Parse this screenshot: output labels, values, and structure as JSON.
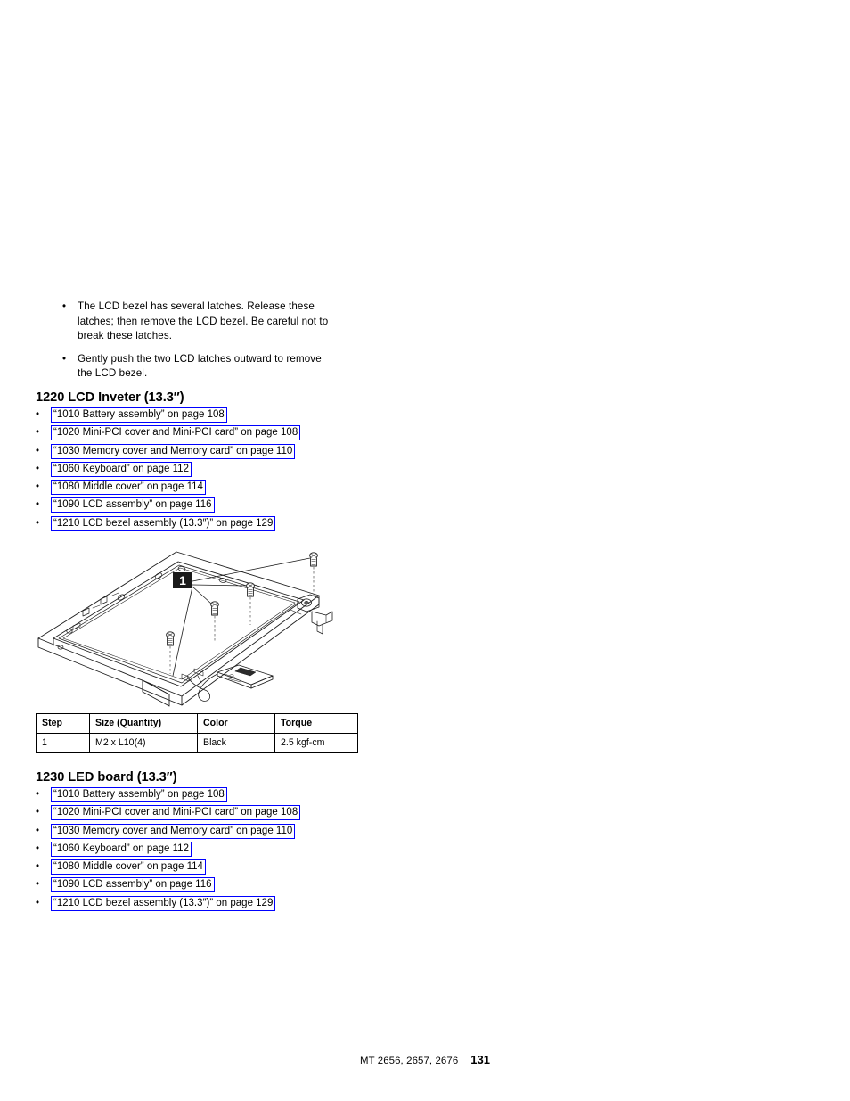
{
  "intro": {
    "bullet_glyph": "•",
    "items": [
      "The LCD bezel has several latches. Release these latches; then remove the LCD bezel. Be careful not to break these latches.",
      "Gently push the two LCD latches outward to remove the LCD bezel."
    ]
  },
  "sections": [
    {
      "heading": "1220 LCD Inveter (13.3″)",
      "links": [
        "“1010 Battery assembly” on page 108",
        "“1020 Mini-PCI cover and Mini-PCI card” on page 108",
        "“1030 Memory cover and Memory card” on page 110",
        "“1060 Keyboard” on page 112",
        "“1080 Middle cover” on page 114",
        "“1090 LCD assembly” on page 116",
        "“1210 LCD bezel assembly (13.3″)” on page 129"
      ]
    },
    {
      "heading": "1230 LED board (13.3″)",
      "links": [
        "“1010 Battery assembly” on page 108",
        "“1020 Mini-PCI cover and Mini-PCI card” on page 108",
        "“1030 Memory cover and Memory card” on page 110",
        "“1060 Keyboard” on page 112",
        "“1080 Middle cover” on page 114",
        "“1090 LCD assembly” on page 116",
        "“1210 LCD bezel assembly (13.3″)” on page 129"
      ]
    }
  ],
  "figure": {
    "callout_label": "1",
    "description": "Exploded isometric line drawing of the LCD bezel assembly with four screws and the LCD inverter board and cable"
  },
  "parts_table": {
    "headers": [
      "Step",
      "Size (Quantity)",
      "Color",
      "Torque"
    ],
    "rows": [
      [
        "1",
        "M2 x L10(4)",
        "Black",
        "2.5 kgf-cm"
      ]
    ]
  },
  "footer": {
    "machine_types": "MT 2656, 2657, 2676",
    "page_number": "131"
  },
  "colors": {
    "link_border": "#0000ff",
    "text": "#000000",
    "callout_background": "#1a1a1a",
    "page_background": "#ffffff"
  }
}
